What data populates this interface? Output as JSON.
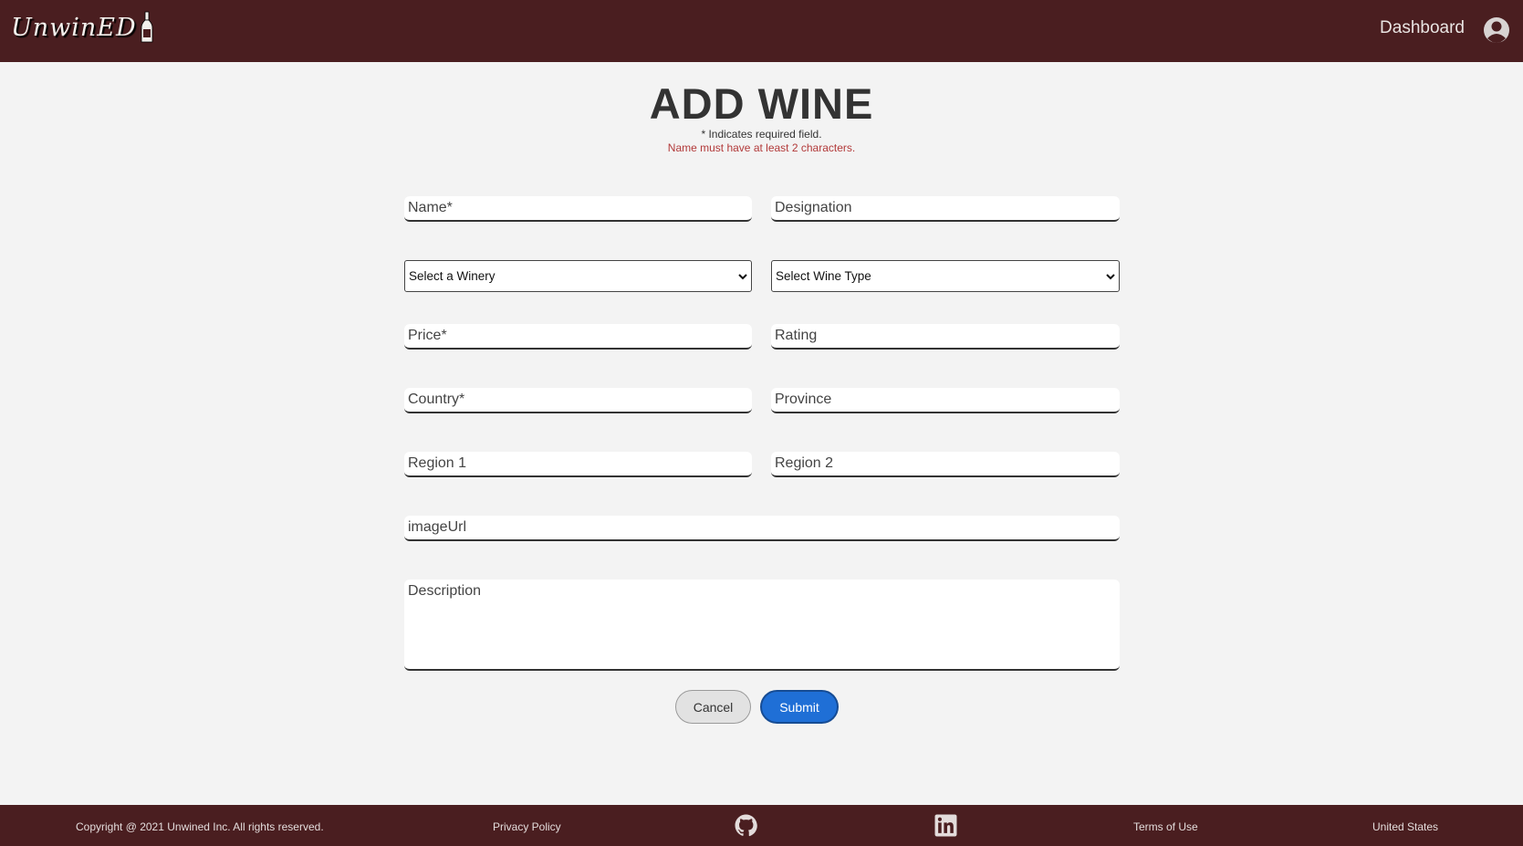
{
  "header": {
    "logo_text": "UnwinED",
    "dashboard_label": "Dashboard",
    "avatar_icon": "user-circle-icon",
    "bar_color": "#4a1e20"
  },
  "page": {
    "title": "ADD WINE",
    "required_note": "* Indicates required field.",
    "error_note": "Name must have at least 2 characters.",
    "error_color": "#b23a3a"
  },
  "form": {
    "name_placeholder": "Name*",
    "designation_placeholder": "Designation",
    "winery_select": "Select a Winery",
    "wine_type_select": "Select Wine Type",
    "price_placeholder": "Price*",
    "rating_placeholder": "Rating",
    "country_placeholder": "Country*",
    "province_placeholder": "Province",
    "region1_placeholder": "Region 1",
    "region2_placeholder": "Region 2",
    "image_url_placeholder": "imageUrl",
    "description_placeholder": "Description",
    "cancel_label": "Cancel",
    "submit_label": "Submit",
    "submit_color": "#1f6fd6"
  },
  "footer": {
    "copyright": "Copyright @ 2021 Unwined Inc. All rights reserved.",
    "privacy": "Privacy Policy",
    "github_icon": "github-icon",
    "linkedin_icon": "linkedin-icon",
    "terms": "Terms of Use",
    "region": "United States"
  }
}
